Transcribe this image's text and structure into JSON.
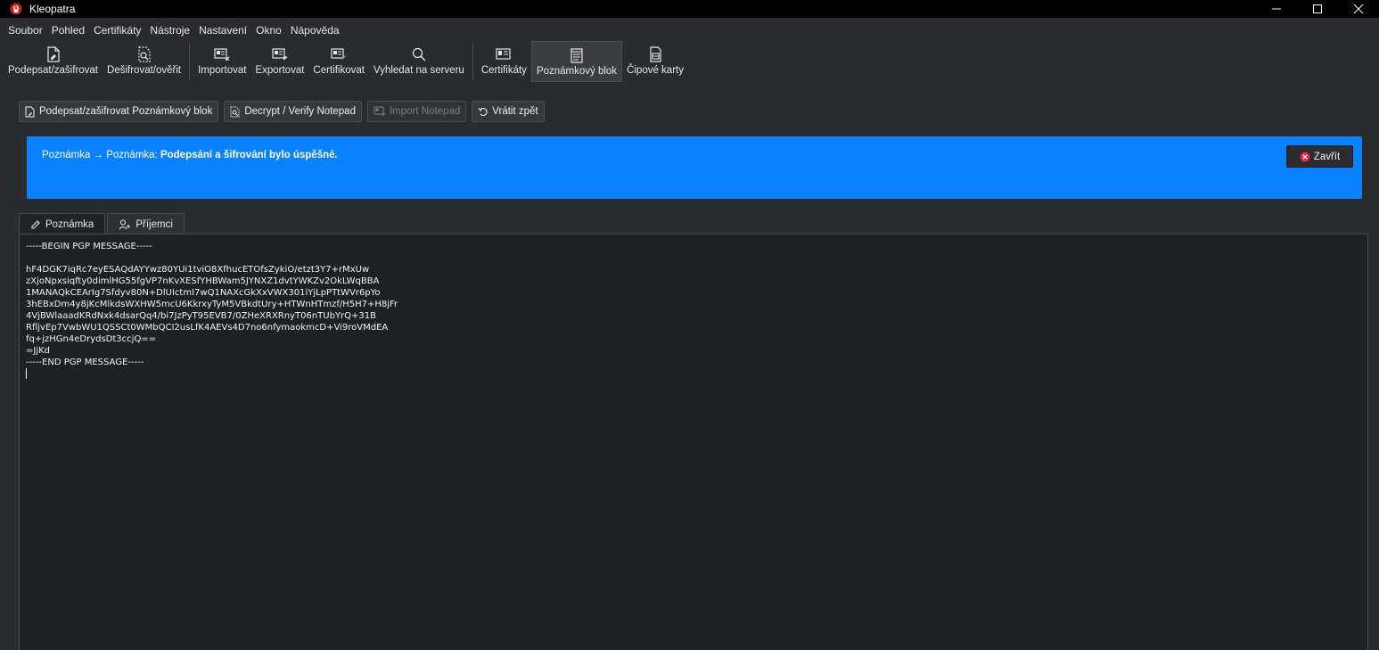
{
  "window": {
    "title": "Kleopatra"
  },
  "menu": [
    "Soubor",
    "Pohled",
    "Certifikáty",
    "Nástroje",
    "Nastavení",
    "Okno",
    "Nápověda"
  ],
  "toolbar": {
    "sign_encrypt": "Podepsat/zašifrovat",
    "decrypt_verify": "Dešifrovat/ověřit",
    "import": "Importovat",
    "export": "Exportovat",
    "certify": "Certifikovat",
    "lookup_server": "Vyhledat na serveru",
    "certificates": "Certifikáty",
    "notepad": "Poznámkový blok",
    "smartcards": "Čipové karty"
  },
  "actions": {
    "sign_encrypt_notepad": "Podepsat/zašifrovat Poznámkový blok",
    "decrypt_verify_notepad": "Decrypt / Verify Notepad",
    "import_notepad": "Import Notepad",
    "revert": "Vrátit zpět"
  },
  "banner": {
    "prefix": "Poznámka → Poznámka: ",
    "message": "Podepsání a šifrování bylo úspěšné.",
    "close_label": "Zavřít",
    "color": "#0a82ff"
  },
  "tabs": {
    "note": "Poznámka",
    "recipients": "Příjemci"
  },
  "editor": {
    "content": "-----BEGIN PGP MESSAGE-----\n\nhF4DGK7iqRc7eyESAQdAYYwz80YUi1tviO8XfhucETOfsZykiO/etzt3Y7+rMxUw\nzXjoNpxsiqfty0dimlHG55fgVP7nKvXESfYHBWam5JYNXZ1dvtYWKZv2OkLWqBBA\n1MANAQkCEArIg7Sfdyv80N+DlUIctmI7wQ1NAXcGkXxVWX301iYjLpPTtWVr6pYo\n3hEBxDm4y8jKcMlkdsWXHW5mcU6KkrxyTyM5VBkdtUry+HTWnHTmzf/H5H7+H8jFr\n4VjBWlaaadKRdNxk4dsarQq4/bi7JzPyT95EVB7/0ZHeXRXRnyT06nTUbYrQ+31B\nRfljvEp7VwbWU1QSSCt0WMbQCI2usLfK4AEVs4D7no6nfymaokmcD+Vi9roVMdEA\nfq+jzHGn4eDrydsDt3ccjQ==\n=JjKd\n-----END PGP MESSAGE-----\n"
  }
}
